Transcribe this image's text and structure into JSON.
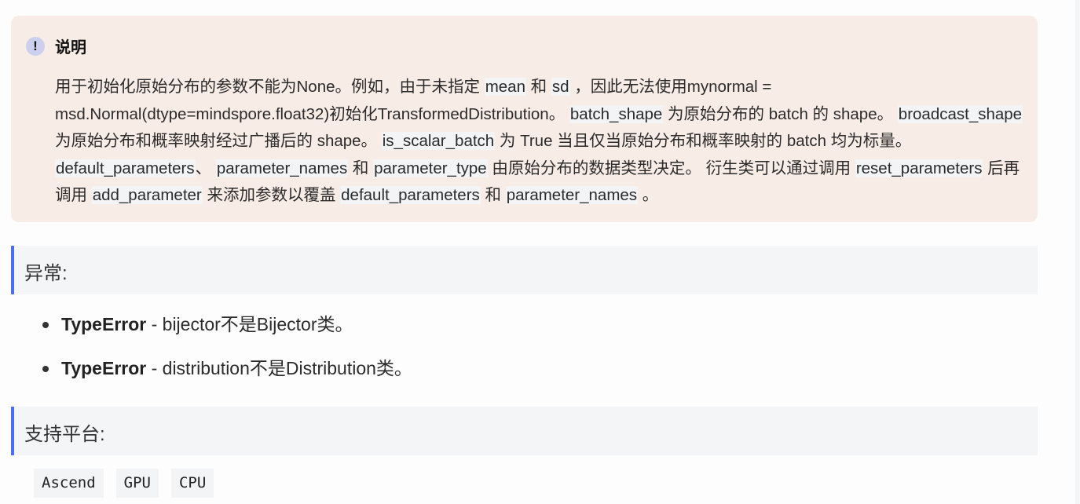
{
  "note": {
    "icon": "exclamation-icon",
    "title": "说明",
    "segments": [
      {
        "t": "用于初始化原始分布的参数不能为None。例如，由于未指定 "
      },
      {
        "t": "mean",
        "code": true
      },
      {
        "t": " 和 "
      },
      {
        "t": "sd",
        "code": true
      },
      {
        "t": " ，因此无法使用mynormal = msd.Normal(dtype=mindspore.float32)初始化TransformedDistribution。 "
      },
      {
        "t": "batch_shape",
        "code": true
      },
      {
        "t": " 为原始分布的 batch 的 shape。 "
      },
      {
        "t": "broadcast_shape",
        "code": true
      },
      {
        "t": " 为原始分布和概率映射经过广播后的 shape。 "
      },
      {
        "t": "is_scalar_batch",
        "code": true
      },
      {
        "t": " 为 True 当且仅当原始分布和概率映射的 batch 均为标量。 "
      },
      {
        "t": "default_parameters",
        "code": true
      },
      {
        "t": "、 "
      },
      {
        "t": "parameter_names",
        "code": true
      },
      {
        "t": " 和 "
      },
      {
        "t": "parameter_type",
        "code": true
      },
      {
        "t": " 由原始分布的数据类型决定。 衍生类可以通过调用 "
      },
      {
        "t": "reset_parameters",
        "code": true
      },
      {
        "t": " 后再调用 "
      },
      {
        "t": "add_parameter",
        "code": true
      },
      {
        "t": " 来添加参数以覆盖 "
      },
      {
        "t": "default_parameters",
        "code": true
      },
      {
        "t": " 和 "
      },
      {
        "t": "parameter_names",
        "code": true
      },
      {
        "t": " 。"
      }
    ]
  },
  "raises": {
    "heading": "异常:",
    "items": [
      {
        "type": "TypeError",
        "desc": " - bijector不是Bijector类。"
      },
      {
        "type": "TypeError",
        "desc": " - distribution不是Distribution类。"
      }
    ]
  },
  "platforms": {
    "heading": "支持平台:",
    "tags": [
      "Ascend",
      "GPU",
      "CPU"
    ]
  },
  "colors": {
    "note_bg": "#f8ece6",
    "accent": "#4e6ef2",
    "section_bg": "#f4f5f7"
  }
}
